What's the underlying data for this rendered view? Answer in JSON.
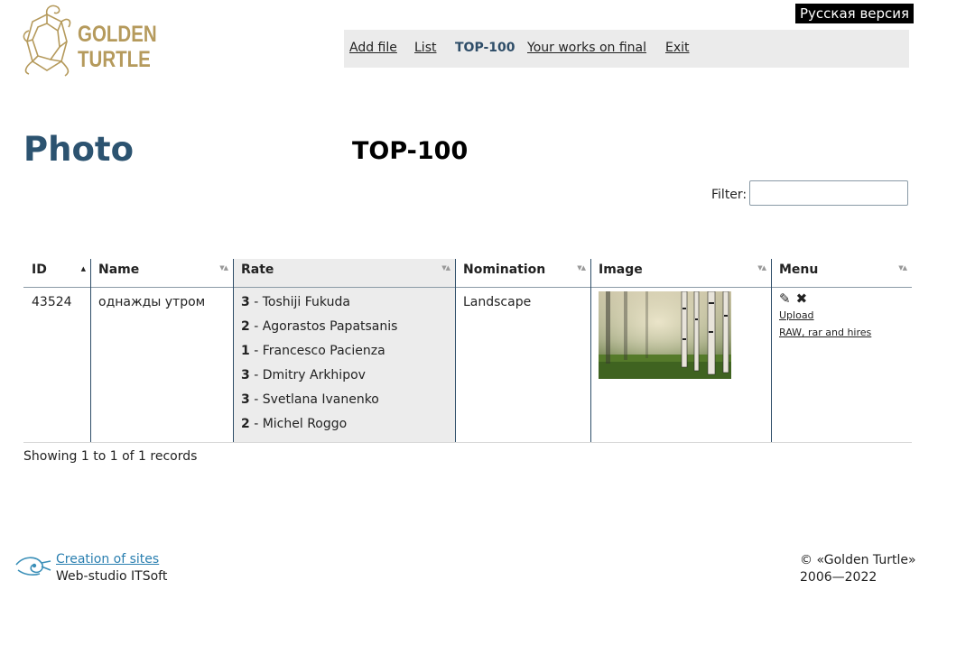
{
  "logo": {
    "line1": "GOLDEN",
    "line2": "TURTLE"
  },
  "lang_switch": "Русская версия",
  "nav": [
    {
      "label": "Add file"
    },
    {
      "label": "List"
    },
    {
      "label": "TOP-100",
      "active": true
    },
    {
      "label": "Your works on final"
    },
    {
      "label": "Exit"
    }
  ],
  "section_title": "Photo",
  "page_title": "TOP-100",
  "filter": {
    "label": "Filter:",
    "value": ""
  },
  "table": {
    "columns": [
      "ID",
      "Name",
      "Rate",
      "Nomination",
      "Image",
      "Menu"
    ],
    "sorted_column": "ID",
    "rows": [
      {
        "id": "43524",
        "name": "однажды утром",
        "rates": [
          {
            "score": "3",
            "juror": "Toshiji Fukuda"
          },
          {
            "score": "2",
            "juror": "Agorastos Papatsanis"
          },
          {
            "score": "1",
            "juror": "Francesco Pacienza"
          },
          {
            "score": "3",
            "juror": "Dmitry Arkhipov"
          },
          {
            "score": "3",
            "juror": "Svetlana Ivanenko"
          },
          {
            "score": "2",
            "juror": "Michel Roggo"
          }
        ],
        "nomination": "Landscape",
        "image_icon": "birch-forest-photo",
        "menu": {
          "edit_icon": "pencil-icon",
          "delete_icon": "close-icon",
          "upload_label": "Upload",
          "raw_label": "RAW, rar and hires"
        }
      }
    ]
  },
  "showing": "Showing 1 to 1 of 1 records",
  "footer": {
    "creation_link": "Creation of sites",
    "studio": "Web-studio ITSoft",
    "copyright_line1": "© «Golden Turtle»",
    "copyright_line2": "2006—2022"
  },
  "colors": {
    "title": "#2c5370",
    "nav_bg": "#ebebeb",
    "sorted_bg": "#ececec",
    "logo_gold": "#b59a5c",
    "link": "#2a7fb0"
  }
}
